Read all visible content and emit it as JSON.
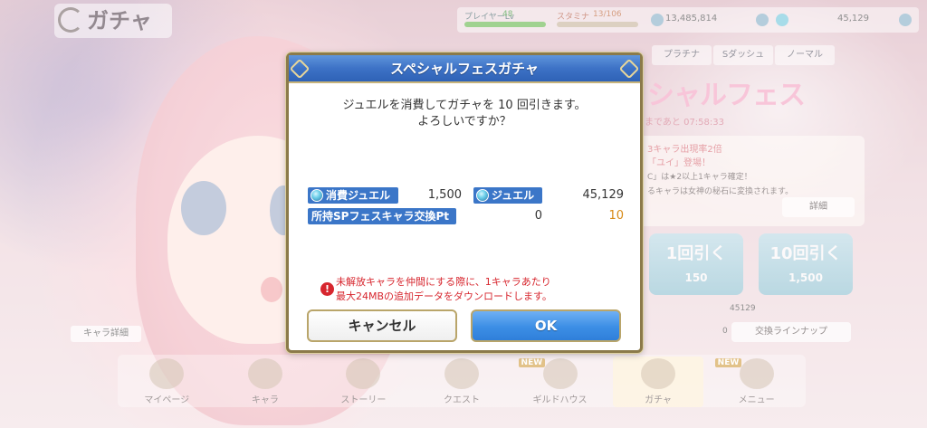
{
  "header": {
    "title": "ガチャ"
  },
  "status": {
    "player_level_label": "プレイヤーLv",
    "player_level": "48",
    "stamina_label": "スタミナ",
    "stamina": "13/106",
    "mana": "13,485,814",
    "jewels": "45,129"
  },
  "background": {
    "tabs": [
      "プラチナ",
      "Sダッシュ",
      "ノーマル"
    ],
    "banner_title": "シャルフェス",
    "banner_sub": "まであと 07:58:33",
    "info_line1": "3キャラ出現率2倍",
    "info_line2": "「ユイ」登場！",
    "info_line3": "C」は★2以上1キャラ確定！",
    "info_line4": "るキャラは女神の秘石に変換されます。",
    "detail_button": "詳細",
    "pull_one": {
      "label": "1回引く",
      "cost": "150"
    },
    "pull_ten": {
      "label": "10回引く",
      "cost": "1,500"
    },
    "pt_value": "45129",
    "pt_zero": "0",
    "exchange_button": "交換ラインナップ",
    "chara_detail_button": "キャラ詳細"
  },
  "nav": {
    "items": [
      {
        "label": "マイページ",
        "badge": ""
      },
      {
        "label": "キャラ",
        "badge": ""
      },
      {
        "label": "ストーリー",
        "badge": ""
      },
      {
        "label": "クエスト",
        "badge": ""
      },
      {
        "label": "ギルドハウス",
        "badge": "NEW"
      },
      {
        "label": "ガチャ",
        "badge": ""
      },
      {
        "label": "メニュー",
        "badge": "NEW"
      }
    ]
  },
  "dialog": {
    "title": "スペシャルフェスガチャ",
    "message_line1": "ジュエルを消費してガチャを 10 回引きます。",
    "message_line2": "よろしいですか？",
    "cost_label": "消費ジュエル",
    "cost_value": "1,500",
    "jewel_label": "ジュエル",
    "jewel_value": "45,129",
    "sp_label": "所持SPフェスキャラ交換Pt",
    "sp_before": "0",
    "sp_after": "10",
    "warning_line1": "未解放キャラを仲間にする際に、1キャラあたり",
    "warning_line2": "最大24MBの追加データをダウンロードします。",
    "cancel_label": "キャンセル",
    "ok_label": "OK"
  },
  "colors": {
    "dialog_header": "#3d72c6",
    "ok_button": "#3c8ee5",
    "warning": "#d7262e",
    "sp_after": "#d78a17"
  }
}
